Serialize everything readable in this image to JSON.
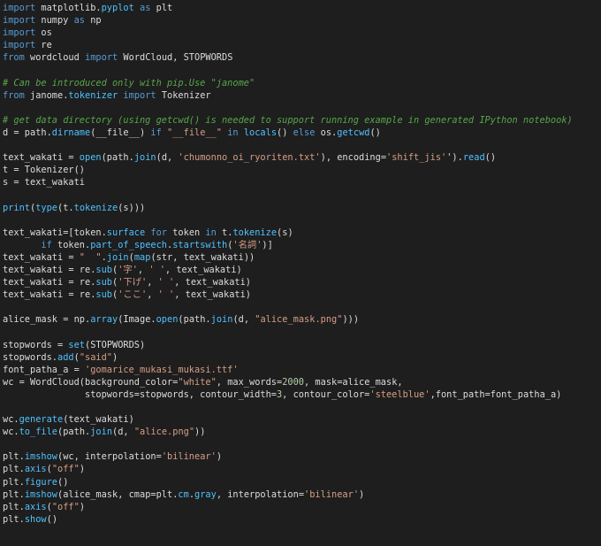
{
  "editor": {
    "lines": [
      [
        [
          "kw",
          "import"
        ],
        [
          "id",
          " matplotlib."
        ],
        [
          "fn",
          "pyplot"
        ],
        [
          "id",
          " "
        ],
        [
          "kw",
          "as"
        ],
        [
          "id",
          " plt"
        ]
      ],
      [
        [
          "kw",
          "import"
        ],
        [
          "id",
          " numpy "
        ],
        [
          "kw",
          "as"
        ],
        [
          "id",
          " np"
        ]
      ],
      [
        [
          "kw",
          "import"
        ],
        [
          "id",
          " os"
        ]
      ],
      [
        [
          "kw",
          "import"
        ],
        [
          "id",
          " re"
        ]
      ],
      [
        [
          "kw",
          "from"
        ],
        [
          "id",
          " wordcloud "
        ],
        [
          "kw",
          "import"
        ],
        [
          "id",
          " WordCloud, STOPWORDS"
        ]
      ],
      [],
      [
        [
          "cm",
          "# Can be introduced only with pip.Use \"janome\""
        ]
      ],
      [
        [
          "kw",
          "from"
        ],
        [
          "id",
          " janome."
        ],
        [
          "fn",
          "tokenizer"
        ],
        [
          "id",
          " "
        ],
        [
          "kw",
          "import"
        ],
        [
          "id",
          " Tokenizer"
        ]
      ],
      [],
      [
        [
          "cm",
          "# get data directory (using getcwd() is needed to support running example in generated IPython notebook)"
        ]
      ],
      [
        [
          "id",
          "d = path."
        ],
        [
          "fn",
          "dirname"
        ],
        [
          "id",
          "(__file__) "
        ],
        [
          "kw",
          "if"
        ],
        [
          "id",
          " "
        ],
        [
          "st",
          "\"__file__\""
        ],
        [
          "id",
          " "
        ],
        [
          "kw",
          "in"
        ],
        [
          "id",
          " "
        ],
        [
          "fn",
          "locals"
        ],
        [
          "id",
          "() "
        ],
        [
          "kw",
          "else"
        ],
        [
          "id",
          " os."
        ],
        [
          "fn",
          "getcwd"
        ],
        [
          "id",
          "()"
        ]
      ],
      [],
      [
        [
          "id",
          "text_wakati = "
        ],
        [
          "fn",
          "open"
        ],
        [
          "id",
          "(path."
        ],
        [
          "fn",
          "join"
        ],
        [
          "id",
          "(d, "
        ],
        [
          "st",
          "'chumonno_oi_ryoriten.txt'"
        ],
        [
          "id",
          "), encoding="
        ],
        [
          "st",
          "'shift_jis'"
        ],
        [
          "id",
          "')."
        ],
        [
          "fn",
          "read"
        ],
        [
          "id",
          "()"
        ]
      ],
      [
        [
          "id",
          "t = Tokenizer()"
        ]
      ],
      [
        [
          "id",
          "s = text_wakati"
        ]
      ],
      [],
      [
        [
          "fn",
          "print"
        ],
        [
          "id",
          "("
        ],
        [
          "fn",
          "type"
        ],
        [
          "id",
          "(t."
        ],
        [
          "fn",
          "tokenize"
        ],
        [
          "id",
          "(s)))"
        ]
      ],
      [],
      [
        [
          "id",
          "text_wakati=[token."
        ],
        [
          "fn",
          "surface"
        ],
        [
          "id",
          " "
        ],
        [
          "kw",
          "for"
        ],
        [
          "id",
          " token "
        ],
        [
          "kw",
          "in"
        ],
        [
          "id",
          " t."
        ],
        [
          "fn",
          "tokenize"
        ],
        [
          "id",
          "(s)"
        ]
      ],
      [
        [
          "id",
          "       "
        ],
        [
          "kw",
          "if"
        ],
        [
          "id",
          " token."
        ],
        [
          "fn",
          "part_of_speech"
        ],
        [
          "id",
          "."
        ],
        [
          "fn",
          "startswith"
        ],
        [
          "id",
          "("
        ],
        [
          "st",
          "'名詞'"
        ],
        [
          "id",
          ")]"
        ]
      ],
      [
        [
          "id",
          "text_wakati = "
        ],
        [
          "st",
          "\"  \""
        ],
        [
          "id",
          "."
        ],
        [
          "fn",
          "join"
        ],
        [
          "id",
          "("
        ],
        [
          "fn",
          "map"
        ],
        [
          "id",
          "(str, text_wakati))"
        ]
      ],
      [
        [
          "id",
          "text_wakati = re."
        ],
        [
          "fn",
          "sub"
        ],
        [
          "id",
          "("
        ],
        [
          "st",
          "'字'"
        ],
        [
          "id",
          ", "
        ],
        [
          "st",
          "' '"
        ],
        [
          "id",
          ", text_wakati)"
        ]
      ],
      [
        [
          "id",
          "text_wakati = re."
        ],
        [
          "fn",
          "sub"
        ],
        [
          "id",
          "("
        ],
        [
          "st",
          "'下げ'"
        ],
        [
          "id",
          ", "
        ],
        [
          "st",
          "' '"
        ],
        [
          "id",
          ", text_wakati)"
        ]
      ],
      [
        [
          "id",
          "text_wakati = re."
        ],
        [
          "fn",
          "sub"
        ],
        [
          "id",
          "("
        ],
        [
          "st",
          "'ここ'"
        ],
        [
          "id",
          ", "
        ],
        [
          "st",
          "' '"
        ],
        [
          "id",
          ", text_wakati)"
        ]
      ],
      [],
      [
        [
          "id",
          "alice_mask = np."
        ],
        [
          "fn",
          "array"
        ],
        [
          "id",
          "(Image."
        ],
        [
          "fn",
          "open"
        ],
        [
          "id",
          "(path."
        ],
        [
          "fn",
          "join"
        ],
        [
          "id",
          "(d, "
        ],
        [
          "st",
          "\"alice_mask.png\""
        ],
        [
          "id",
          ")))"
        ]
      ],
      [],
      [
        [
          "id",
          "stopwords = "
        ],
        [
          "fn",
          "set"
        ],
        [
          "id",
          "(STOPWORDS)"
        ]
      ],
      [
        [
          "id",
          "stopwords."
        ],
        [
          "fn",
          "add"
        ],
        [
          "id",
          "("
        ],
        [
          "st",
          "\"said\""
        ],
        [
          "id",
          ")"
        ]
      ],
      [
        [
          "id",
          "font_patha_a = "
        ],
        [
          "st",
          "'gomarice_mukasi_mukasi.ttf'"
        ]
      ],
      [
        [
          "id",
          "wc = WordCloud(background_color="
        ],
        [
          "st",
          "\"white\""
        ],
        [
          "id",
          ", max_words="
        ],
        [
          "nu",
          "2000"
        ],
        [
          "id",
          ", mask=alice_mask,"
        ]
      ],
      [
        [
          "id",
          "               stopwords=stopwords, contour_width="
        ],
        [
          "nu",
          "3"
        ],
        [
          "id",
          ", contour_color="
        ],
        [
          "st",
          "'steelblue'"
        ],
        [
          "id",
          ",font_path=font_patha_a)"
        ]
      ],
      [],
      [
        [
          "id",
          "wc."
        ],
        [
          "fn",
          "generate"
        ],
        [
          "id",
          "(text_wakati)"
        ]
      ],
      [
        [
          "id",
          "wc."
        ],
        [
          "fn",
          "to_file"
        ],
        [
          "id",
          "(path."
        ],
        [
          "fn",
          "join"
        ],
        [
          "id",
          "(d, "
        ],
        [
          "st",
          "\"alice.png\""
        ],
        [
          "id",
          "))"
        ]
      ],
      [],
      [
        [
          "id",
          "plt."
        ],
        [
          "fn",
          "imshow"
        ],
        [
          "id",
          "(wc, interpolation="
        ],
        [
          "st",
          "'bilinear'"
        ],
        [
          "id",
          ")"
        ]
      ],
      [
        [
          "id",
          "plt."
        ],
        [
          "fn",
          "axis"
        ],
        [
          "id",
          "("
        ],
        [
          "st",
          "\"off\""
        ],
        [
          "id",
          ")"
        ]
      ],
      [
        [
          "id",
          "plt."
        ],
        [
          "fn",
          "figure"
        ],
        [
          "id",
          "()"
        ]
      ],
      [
        [
          "id",
          "plt."
        ],
        [
          "fn",
          "imshow"
        ],
        [
          "id",
          "(alice_mask, cmap=plt."
        ],
        [
          "fn",
          "cm"
        ],
        [
          "id",
          "."
        ],
        [
          "fn",
          "gray"
        ],
        [
          "id",
          ", interpolation="
        ],
        [
          "st",
          "'bilinear'"
        ],
        [
          "id",
          ")"
        ]
      ],
      [
        [
          "id",
          "plt."
        ],
        [
          "fn",
          "axis"
        ],
        [
          "id",
          "("
        ],
        [
          "st",
          "\"off\""
        ],
        [
          "id",
          ")"
        ]
      ],
      [
        [
          "id",
          "plt."
        ],
        [
          "fn",
          "show"
        ],
        [
          "id",
          "()"
        ]
      ]
    ]
  }
}
